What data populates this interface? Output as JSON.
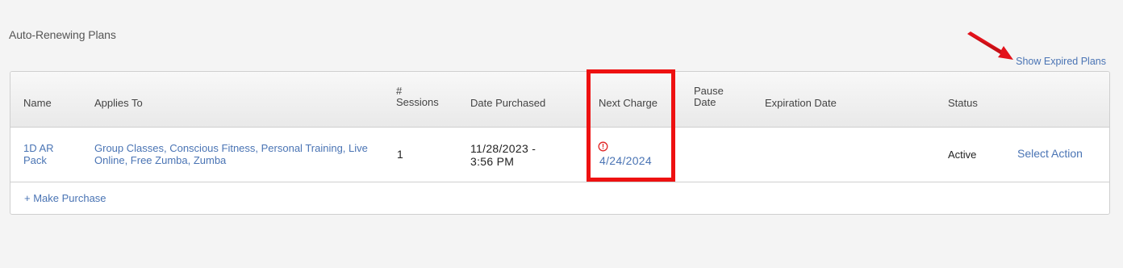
{
  "section_title": "Auto-Renewing Plans",
  "show_expired_label": "Show Expired Plans",
  "columns": {
    "name": "Name",
    "applies_to": "Applies To",
    "sessions_line1": "#",
    "sessions_line2": "Sessions",
    "date_purchased": "Date Purchased",
    "next_charge": "Next Charge",
    "pause_line1": "Pause",
    "pause_line2": "Date",
    "expiration_date": "Expiration Date",
    "status": "Status"
  },
  "rows": [
    {
      "name_line1": "1D AR",
      "name_line2": "Pack",
      "applies_line1": "Group Classes, Conscious Fitness, Personal Training, Live",
      "applies_line2": "Online, Free Zumba, Zumba",
      "sessions": "1",
      "date_line1": "11/28/2023 -",
      "date_line2": "3:56 PM",
      "next_charge": "4/24/2024",
      "pause_date": "",
      "expiration_date": "",
      "status": "Active",
      "action": "Select Action"
    }
  ],
  "make_purchase_label": "+ Make Purchase",
  "colors": {
    "link": "#4a74b4",
    "alert": "#ee1111",
    "highlight": "#ee1111"
  },
  "icons": {
    "next_charge_alert": "alert-circle-icon",
    "annotation_arrow": "red-arrow-icon"
  }
}
